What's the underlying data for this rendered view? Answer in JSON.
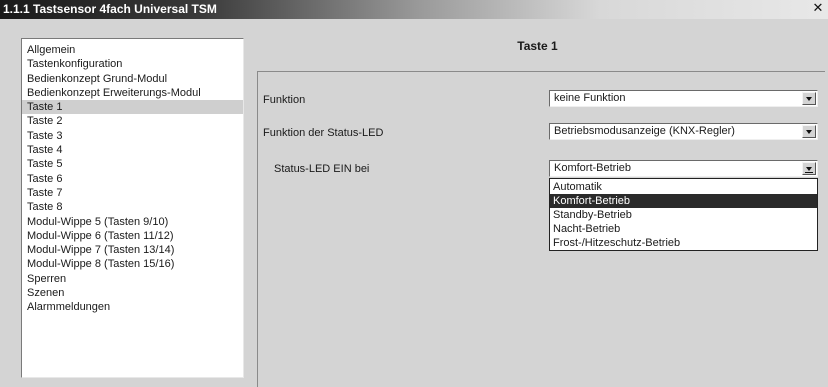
{
  "window": {
    "title": "1.1.1 Tastsensor 4fach Universal TSM"
  },
  "sidebar": {
    "items": [
      {
        "label": "Allgemein",
        "selected": false
      },
      {
        "label": "Tastenkonfiguration",
        "selected": false
      },
      {
        "label": "Bedienkonzept Grund-Modul",
        "selected": false
      },
      {
        "label": "Bedienkonzept Erweiterungs-Modul",
        "selected": false
      },
      {
        "label": "Taste 1",
        "selected": true
      },
      {
        "label": "Taste 2",
        "selected": false
      },
      {
        "label": "Taste 3",
        "selected": false
      },
      {
        "label": "Taste 4",
        "selected": false
      },
      {
        "label": "Taste 5",
        "selected": false
      },
      {
        "label": "Taste 6",
        "selected": false
      },
      {
        "label": "Taste 7",
        "selected": false
      },
      {
        "label": "Taste 8",
        "selected": false
      },
      {
        "label": "Modul-Wippe 5 (Tasten 9/10)",
        "selected": false
      },
      {
        "label": "Modul-Wippe 6 (Tasten 11/12)",
        "selected": false
      },
      {
        "label": "Modul-Wippe 7 (Tasten 13/14)",
        "selected": false
      },
      {
        "label": "Modul-Wippe 8 (Tasten 15/16)",
        "selected": false
      },
      {
        "label": "Sperren",
        "selected": false
      },
      {
        "label": "Szenen",
        "selected": false
      },
      {
        "label": "Alarmmeldungen",
        "selected": false
      }
    ]
  },
  "panel": {
    "title": "Taste 1",
    "fields": {
      "funktion": {
        "label": "Funktion",
        "value": "keine Funktion"
      },
      "status_led_funktion": {
        "label": "Funktion der Status-LED",
        "value": "Betriebsmodusanzeige (KNX-Regler)"
      },
      "status_led_ein": {
        "label": "Status-LED EIN bei",
        "value": "Komfort-Betrieb"
      }
    },
    "dropdown": {
      "options": [
        {
          "label": "Automatik",
          "selected": false
        },
        {
          "label": "Komfort-Betrieb",
          "selected": true
        },
        {
          "label": "Standby-Betrieb",
          "selected": false
        },
        {
          "label": "Nacht-Betrieb",
          "selected": false
        },
        {
          "label": "Frost-/Hitzeschutz-Betrieb",
          "selected": false
        }
      ]
    }
  }
}
